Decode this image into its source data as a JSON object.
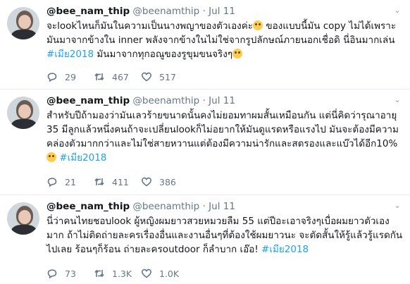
{
  "tweets": [
    {
      "name": "@bee_nam_thip",
      "handle": "@beenamthip",
      "sep": "·",
      "date": "Jul 11",
      "text_main": "จะlookไหนก็มันในความเป็นนางพญาของตัวเองค่ะ",
      "text_after": " ของแบบนี้มัน copy ไม่ได้เพราะมันมาจากข้างใน inner พลังจากข้างในไม่ใช่จากรูปลักษณ์ภายนอกเชื่อดิ นี่อินมากเล่น ",
      "hashtag": "#เมีย2018",
      "text_tail": " มันมาจากทุกอณูของรูขุมขนจริงๆ",
      "replies": "29",
      "retweets": "467",
      "likes": "517"
    },
    {
      "name": "@bee_nam_thip",
      "handle": "@beenamthip",
      "sep": "·",
      "date": "Jul 11",
      "text_main": "สำหรับปีถ้ามองว่ามันเลวร้ายขนาดนั้นคงไม่ยอมทาผมสั้นเหมือนกัน แต่นี่คิดว่ารุณาอายุ 35 มีลูกแล้วหนึ่งคนถ้าจะเปลี่ยนlookก็ไม่อยากให้มันดูแรดหรือแรงไป มันจะต้องมีความคล่องตัวมากกว่าและไม่ใช่สายหวานแต่ต้องมีความน่ารักและสตรองและแบ๊วได้อีก10%",
      "text_after": " ",
      "hashtag": "#เมีย2018",
      "text_tail": "",
      "replies": "21",
      "retweets": "411",
      "likes": "386"
    },
    {
      "name": "@bee_nam_thip",
      "handle": "@beenamthip",
      "sep": "·",
      "date": "Jul 11",
      "text_main": "นี่ว่าคนไทยชอบlook ผู้หญิงผมยาวสวยหมวยลืม 55 แต่ปีอะเอาจริงๆเบื่อผมยาวตัวเองมาก ถ้าไม่ติดถ่ายละครเรื่องอื่นและงานอื่นๆที่ต้องใช้ผมยาวนะ จะตัดสั้นให้รู้แล้วรู้แรดกันไปเลย ร้อนๆก็ร้อน ถ่ายละครoutdoor ก็ลำบาก เอ๊อ!",
      "text_after": " ",
      "hashtag": "#เมีย2018",
      "text_tail": "",
      "replies": "73",
      "retweets": "1.3K",
      "likes": "1.0K"
    }
  ],
  "icons": {
    "reply": "reply-icon",
    "retweet": "retweet-icon",
    "like": "heart-icon",
    "caret": "chevron-down-icon",
    "emoji": "grinning-face-emoji"
  },
  "colors": {
    "hashtag": "#1da1f2",
    "meta": "#657786",
    "divider": "#e6ecf0"
  }
}
